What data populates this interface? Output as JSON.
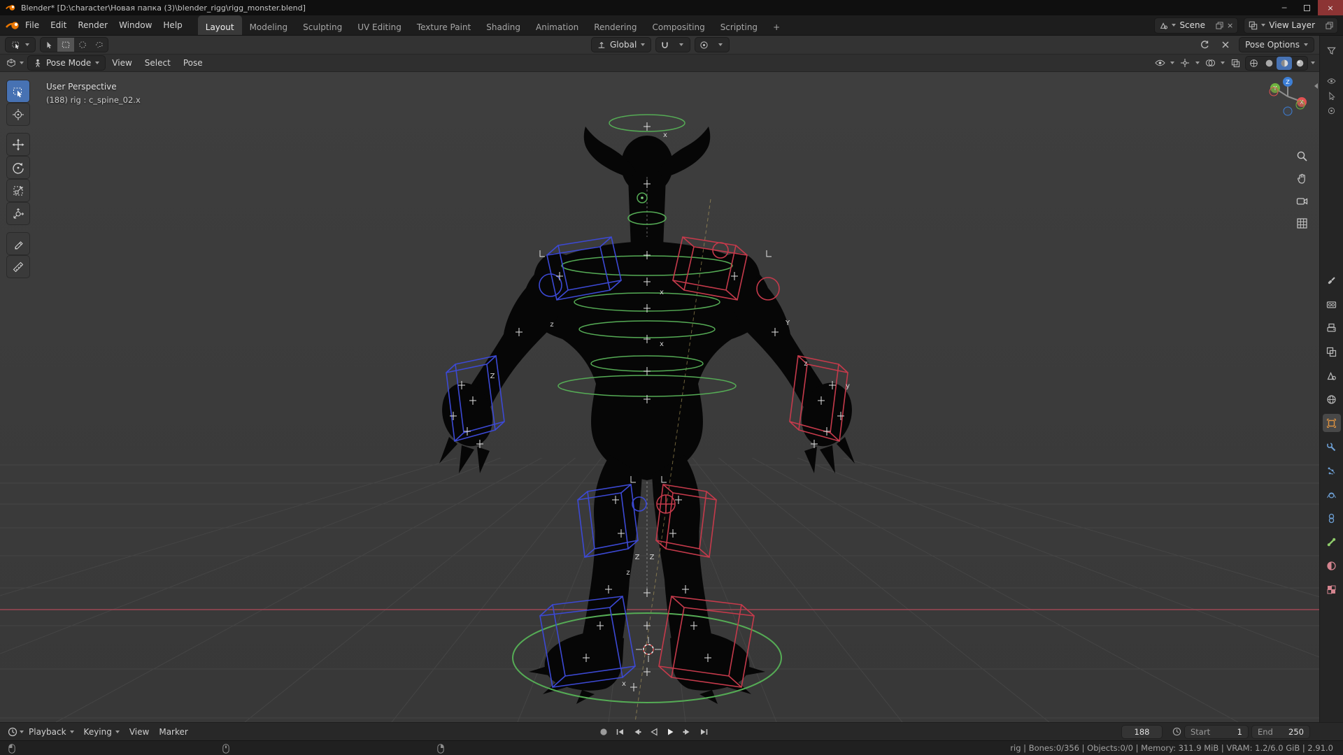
{
  "window": {
    "title": "Blender* [D:\\character\\Новая папка (3)\\blender_rigg\\rigg_monster.blend]",
    "minimize_glyph": "─",
    "close_glyph": "×"
  },
  "topbar": {
    "menus": [
      "File",
      "Edit",
      "Render",
      "Window",
      "Help"
    ],
    "workspace_tabs": [
      "Layout",
      "Modeling",
      "Sculpting",
      "UV Editing",
      "Texture Paint",
      "Shading",
      "Animation",
      "Rendering",
      "Compositing",
      "Scripting"
    ],
    "add_tab_label": "+",
    "scene_name": "Scene",
    "view_layer_name": "View Layer"
  },
  "tool_header": {
    "orientation_label": "Global",
    "options_label": "Pose Options"
  },
  "viewport_header": {
    "mode_label": "Pose Mode",
    "menus": [
      "View",
      "Select",
      "Pose"
    ]
  },
  "viewport": {
    "overlay_line1": "User Perspective",
    "overlay_line2": "(188) rig : c_spine_02.x",
    "gizmo": {
      "x": "X",
      "y": "Y",
      "z": "Z"
    },
    "scene_labels": {
      "a": "x",
      "b": "x",
      "c": "x",
      "d": "Z",
      "e": "Y",
      "f": "z",
      "g": "Z",
      "h": "Z",
      "i": "z",
      "j": "x",
      "k": "z",
      "l": "y"
    }
  },
  "left_toolbar_tools": [
    "select-box",
    "cursor",
    "move",
    "rotate",
    "scale",
    "transform",
    "annotate",
    "measure"
  ],
  "right_tab_icons": [
    "tool",
    "render",
    "output",
    "view-layer",
    "scene",
    "world",
    "object",
    "modifiers",
    "particles",
    "physics",
    "constraints",
    "object-data",
    "material",
    "texture"
  ],
  "timeline": {
    "menus": [
      "Playback",
      "Keying",
      "View",
      "Marker"
    ],
    "current_frame": "188",
    "start_label": "Start",
    "start_value": "1",
    "end_label": "End",
    "end_value": "250"
  },
  "status_bar": {
    "hints": [
      "mouse-left",
      "mouse-middle",
      "mouse-right"
    ],
    "stats": "rig | Bones:0/356 | Objects:0/0 | Memory: 311.9 MiB | VRAM: 1.2/6.0 GiB | 2.91.0"
  },
  "colors": {
    "accent": "#4772b3",
    "rig_green": "#55ab55",
    "rig_blue": "#3c49d4",
    "rig_red": "#c53a4b",
    "x_axis_line": "#9e4754"
  }
}
